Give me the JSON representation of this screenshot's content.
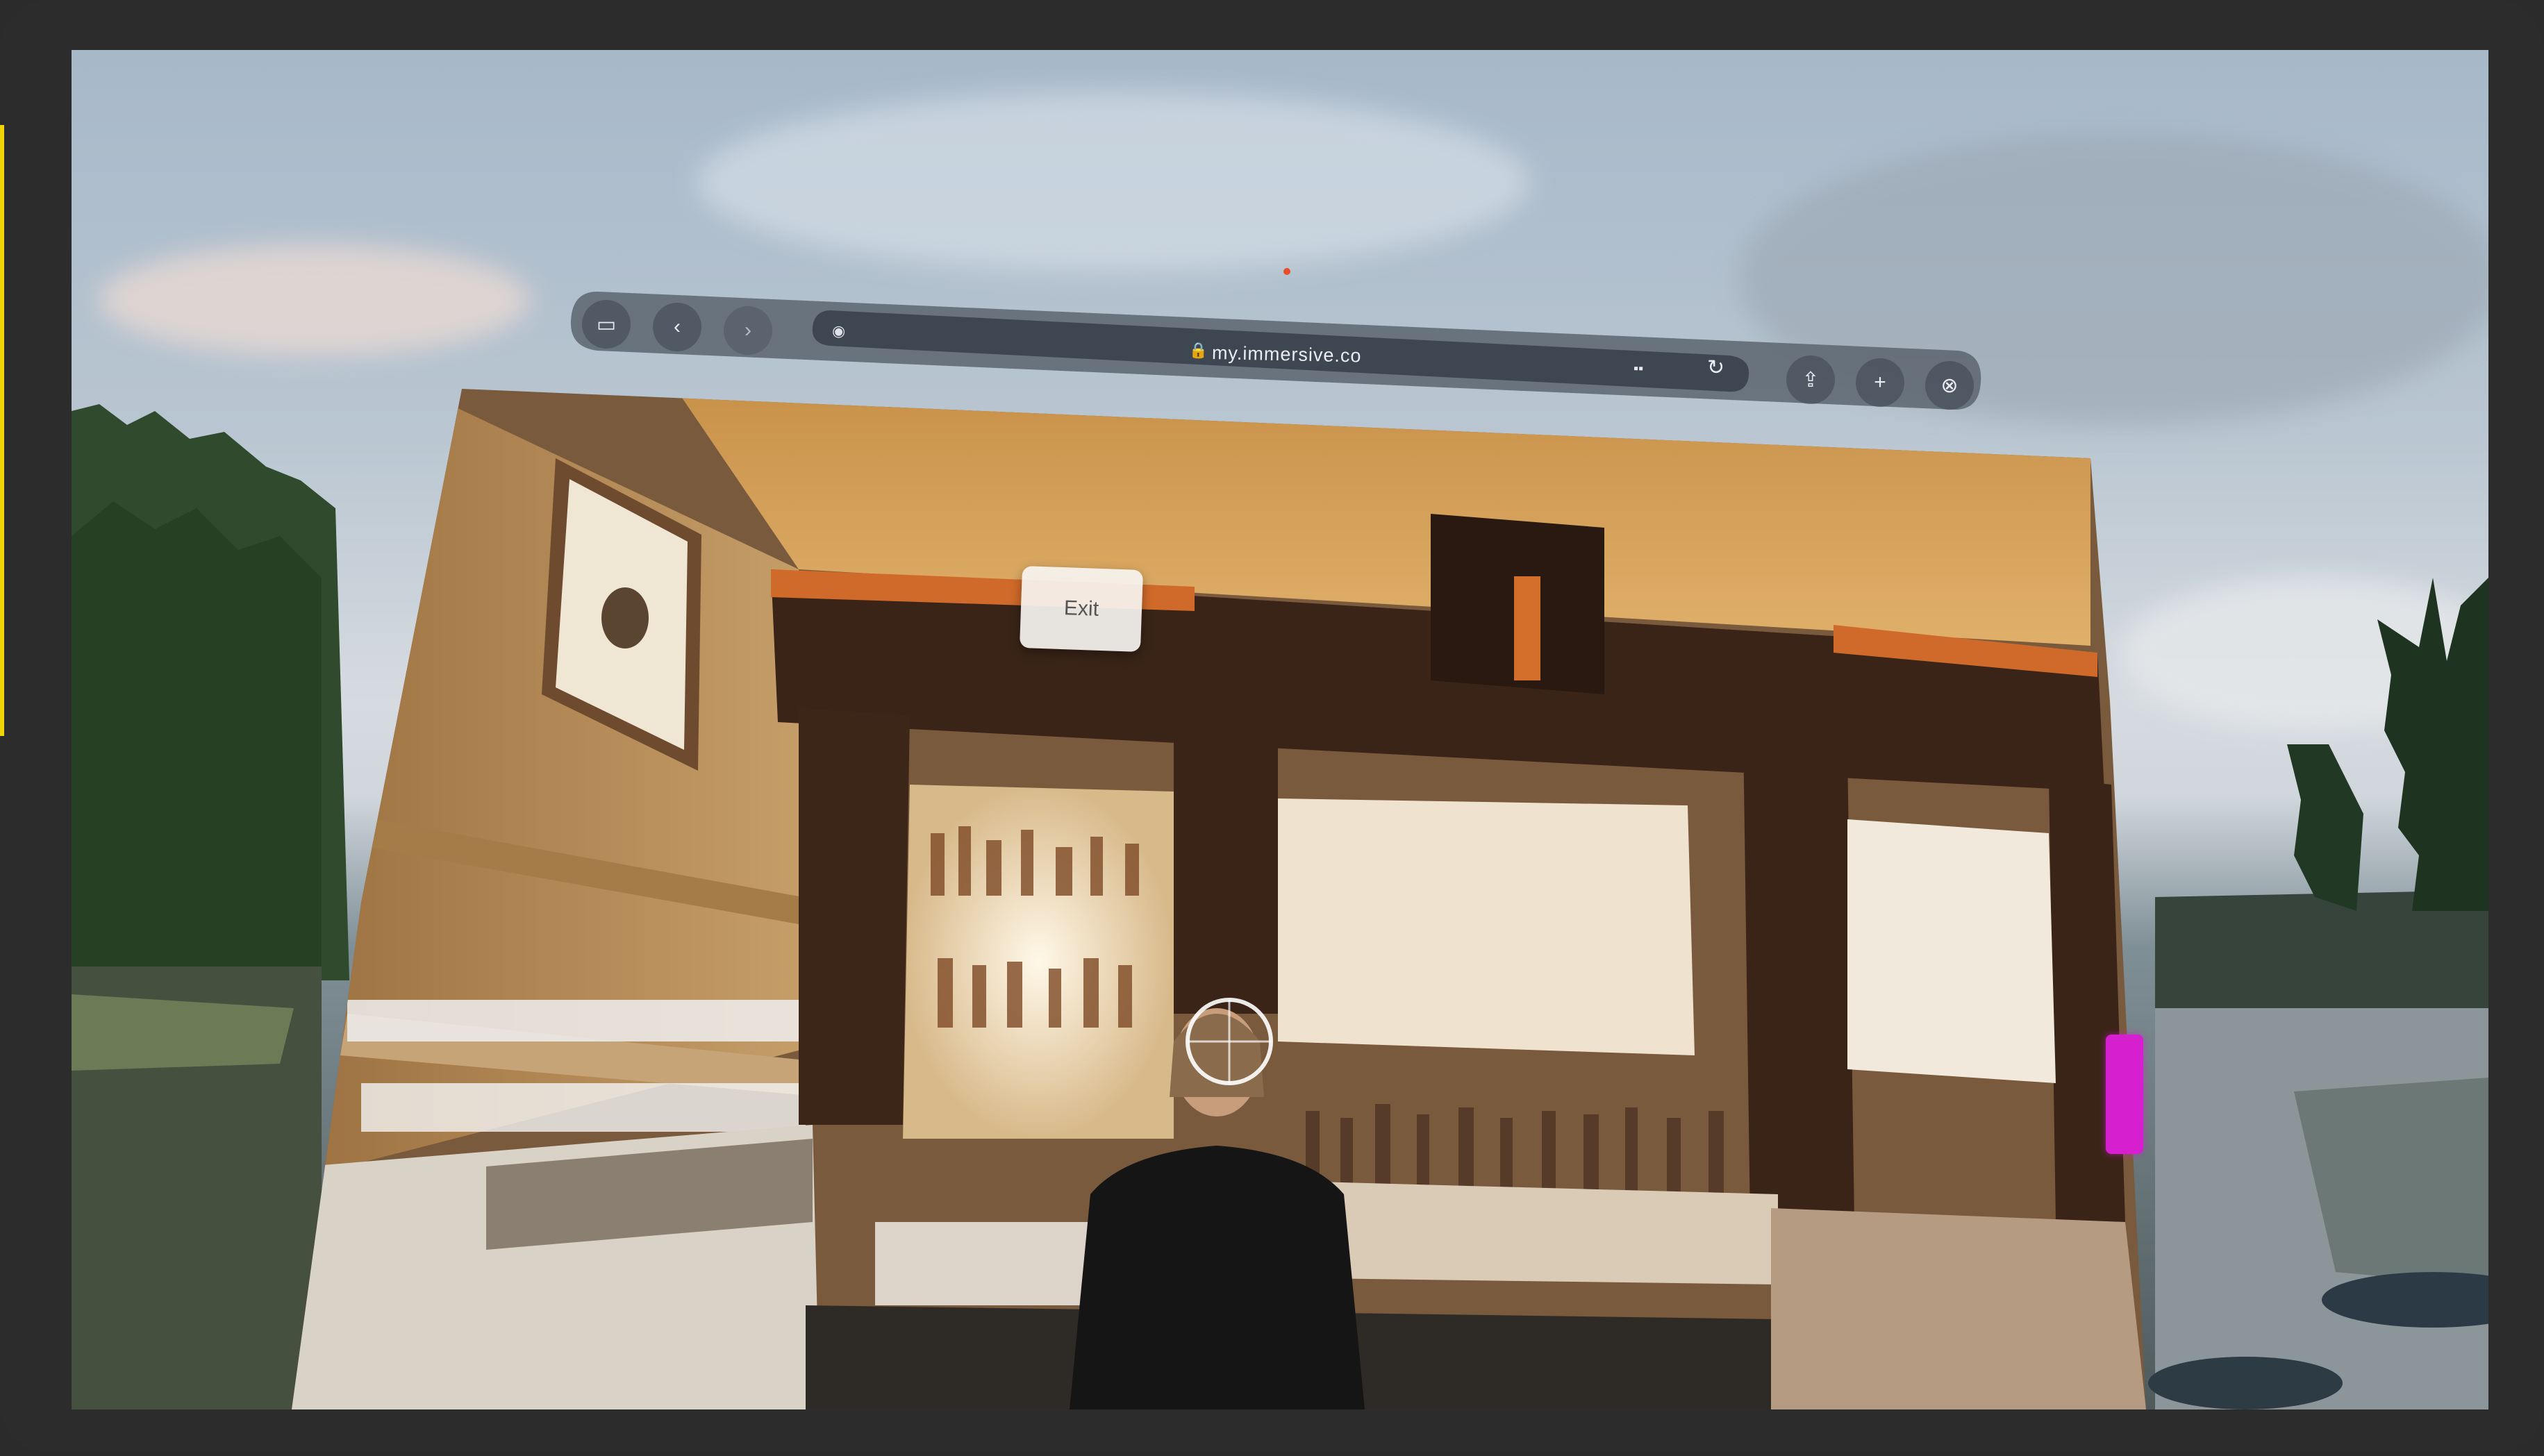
{
  "browser": {
    "url": "my.immersive.co",
    "buttons": {
      "window": "window-icon",
      "back": "back-arrow-icon",
      "forward": "forward-arrow-icon",
      "share": "share-icon",
      "new_tab": "plus-icon",
      "close": "close-icon",
      "reload": "reload-icon",
      "lock": "lock-icon"
    }
  },
  "webview": {
    "exit_label": "Exit"
  },
  "colors": {
    "frame": "#2c2c2c",
    "toolbar": "#5b646f",
    "url_field": "#3c444e",
    "accent_pink": "#d61fcf",
    "marker_yellow": "#f0d300"
  }
}
